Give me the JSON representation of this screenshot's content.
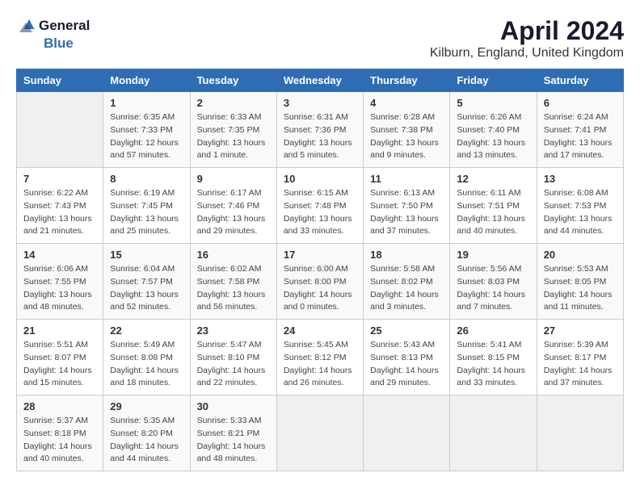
{
  "logo": {
    "general": "General",
    "blue": "Blue"
  },
  "title": "April 2024",
  "subtitle": "Kilburn, England, United Kingdom",
  "header_color": "#2e6db4",
  "days_of_week": [
    "Sunday",
    "Monday",
    "Tuesday",
    "Wednesday",
    "Thursday",
    "Friday",
    "Saturday"
  ],
  "weeks": [
    [
      {
        "day": "",
        "info": ""
      },
      {
        "day": "1",
        "info": "Sunrise: 6:35 AM\nSunset: 7:33 PM\nDaylight: 12 hours\nand 57 minutes."
      },
      {
        "day": "2",
        "info": "Sunrise: 6:33 AM\nSunset: 7:35 PM\nDaylight: 13 hours\nand 1 minute."
      },
      {
        "day": "3",
        "info": "Sunrise: 6:31 AM\nSunset: 7:36 PM\nDaylight: 13 hours\nand 5 minutes."
      },
      {
        "day": "4",
        "info": "Sunrise: 6:28 AM\nSunset: 7:38 PM\nDaylight: 13 hours\nand 9 minutes."
      },
      {
        "day": "5",
        "info": "Sunrise: 6:26 AM\nSunset: 7:40 PM\nDaylight: 13 hours\nand 13 minutes."
      },
      {
        "day": "6",
        "info": "Sunrise: 6:24 AM\nSunset: 7:41 PM\nDaylight: 13 hours\nand 17 minutes."
      }
    ],
    [
      {
        "day": "7",
        "info": "Sunrise: 6:22 AM\nSunset: 7:43 PM\nDaylight: 13 hours\nand 21 minutes."
      },
      {
        "day": "8",
        "info": "Sunrise: 6:19 AM\nSunset: 7:45 PM\nDaylight: 13 hours\nand 25 minutes."
      },
      {
        "day": "9",
        "info": "Sunrise: 6:17 AM\nSunset: 7:46 PM\nDaylight: 13 hours\nand 29 minutes."
      },
      {
        "day": "10",
        "info": "Sunrise: 6:15 AM\nSunset: 7:48 PM\nDaylight: 13 hours\nand 33 minutes."
      },
      {
        "day": "11",
        "info": "Sunrise: 6:13 AM\nSunset: 7:50 PM\nDaylight: 13 hours\nand 37 minutes."
      },
      {
        "day": "12",
        "info": "Sunrise: 6:11 AM\nSunset: 7:51 PM\nDaylight: 13 hours\nand 40 minutes."
      },
      {
        "day": "13",
        "info": "Sunrise: 6:08 AM\nSunset: 7:53 PM\nDaylight: 13 hours\nand 44 minutes."
      }
    ],
    [
      {
        "day": "14",
        "info": "Sunrise: 6:06 AM\nSunset: 7:55 PM\nDaylight: 13 hours\nand 48 minutes."
      },
      {
        "day": "15",
        "info": "Sunrise: 6:04 AM\nSunset: 7:57 PM\nDaylight: 13 hours\nand 52 minutes."
      },
      {
        "day": "16",
        "info": "Sunrise: 6:02 AM\nSunset: 7:58 PM\nDaylight: 13 hours\nand 56 minutes."
      },
      {
        "day": "17",
        "info": "Sunrise: 6:00 AM\nSunset: 8:00 PM\nDaylight: 14 hours\nand 0 minutes."
      },
      {
        "day": "18",
        "info": "Sunrise: 5:58 AM\nSunset: 8:02 PM\nDaylight: 14 hours\nand 3 minutes."
      },
      {
        "day": "19",
        "info": "Sunrise: 5:56 AM\nSunset: 8:03 PM\nDaylight: 14 hours\nand 7 minutes."
      },
      {
        "day": "20",
        "info": "Sunrise: 5:53 AM\nSunset: 8:05 PM\nDaylight: 14 hours\nand 11 minutes."
      }
    ],
    [
      {
        "day": "21",
        "info": "Sunrise: 5:51 AM\nSunset: 8:07 PM\nDaylight: 14 hours\nand 15 minutes."
      },
      {
        "day": "22",
        "info": "Sunrise: 5:49 AM\nSunset: 8:08 PM\nDaylight: 14 hours\nand 18 minutes."
      },
      {
        "day": "23",
        "info": "Sunrise: 5:47 AM\nSunset: 8:10 PM\nDaylight: 14 hours\nand 22 minutes."
      },
      {
        "day": "24",
        "info": "Sunrise: 5:45 AM\nSunset: 8:12 PM\nDaylight: 14 hours\nand 26 minutes."
      },
      {
        "day": "25",
        "info": "Sunrise: 5:43 AM\nSunset: 8:13 PM\nDaylight: 14 hours\nand 29 minutes."
      },
      {
        "day": "26",
        "info": "Sunrise: 5:41 AM\nSunset: 8:15 PM\nDaylight: 14 hours\nand 33 minutes."
      },
      {
        "day": "27",
        "info": "Sunrise: 5:39 AM\nSunset: 8:17 PM\nDaylight: 14 hours\nand 37 minutes."
      }
    ],
    [
      {
        "day": "28",
        "info": "Sunrise: 5:37 AM\nSunset: 8:18 PM\nDaylight: 14 hours\nand 40 minutes."
      },
      {
        "day": "29",
        "info": "Sunrise: 5:35 AM\nSunset: 8:20 PM\nDaylight: 14 hours\nand 44 minutes."
      },
      {
        "day": "30",
        "info": "Sunrise: 5:33 AM\nSunset: 8:21 PM\nDaylight: 14 hours\nand 48 minutes."
      },
      {
        "day": "",
        "info": ""
      },
      {
        "day": "",
        "info": ""
      },
      {
        "day": "",
        "info": ""
      },
      {
        "day": "",
        "info": ""
      }
    ]
  ]
}
